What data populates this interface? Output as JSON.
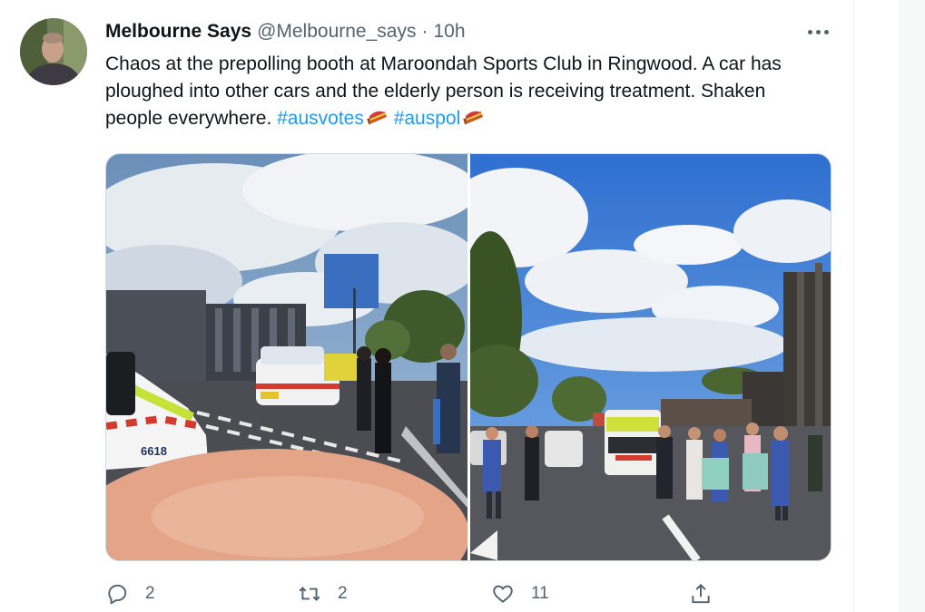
{
  "tweet": {
    "display_name": "Melbourne Says",
    "handle": "@Melbourne_says",
    "separator": "·",
    "time": "10h",
    "text_main": "Chaos at the prepolling booth at Maroondah Sports Club in Ringwood. A car has ploughed into other cars and the elderly person is receiving treatment. Shaken people everywhere. ",
    "hashtags": [
      "#ausvotes",
      "#auspol"
    ],
    "hashtag_emoji": "ballot-box-sausage-emoji"
  },
  "media": {
    "photos": [
      "street-scene-police-car-pedestrians",
      "crowd-ambulance-building-blue-sky"
    ],
    "visible_plates": {
      "car_number": "6618"
    }
  },
  "actions": {
    "reply_count": "2",
    "retweet_count": "2",
    "like_count": "11"
  },
  "icons": {
    "reply": "reply-icon",
    "retweet": "retweet-icon",
    "like": "heart-icon",
    "share": "share-icon",
    "more": "more-icon"
  },
  "colors": {
    "link": "#1d9bf0",
    "secondary_text": "#536471",
    "border": "#cfd9de"
  }
}
